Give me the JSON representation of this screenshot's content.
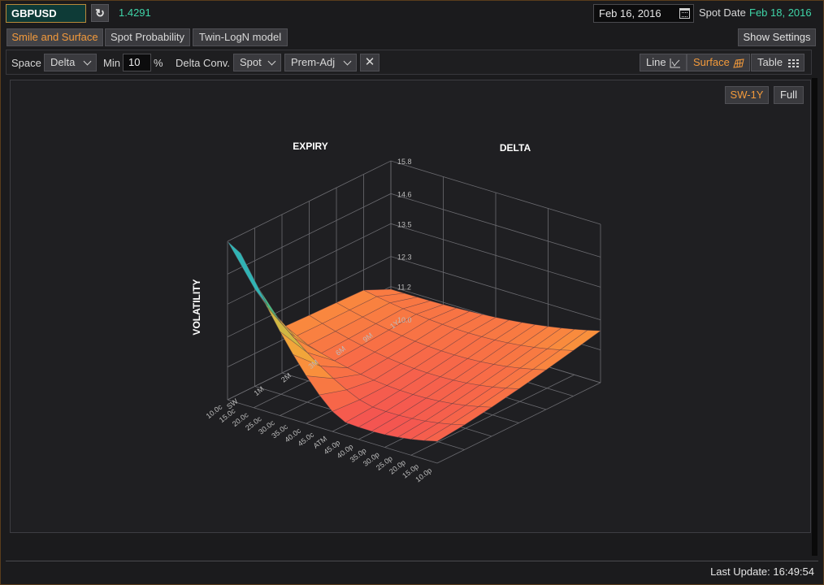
{
  "header": {
    "ticker": "GBPUSD",
    "spot": "1.4291",
    "date": "Feb 16, 2016",
    "spot_date_label": "Spot Date",
    "spot_date_value": "Feb 18, 2016"
  },
  "tabs": [
    {
      "label": "Smile and Surface",
      "active": true
    },
    {
      "label": "Spot Probability",
      "active": false
    },
    {
      "label": "Twin-LogN model",
      "active": false
    }
  ],
  "show_settings": "Show Settings",
  "toolbar": {
    "space_label": "Space",
    "space_value": "Delta",
    "min_label": "Min",
    "min_value": "10",
    "pct": "%",
    "delta_conv_label": "Delta Conv.",
    "delta_conv_value": "Spot",
    "premium_value": "Prem-Adj",
    "clear_symbol": "✕",
    "views": [
      {
        "label": "Line",
        "icon": "line-chart-icon",
        "active": false
      },
      {
        "label": "Surface",
        "icon": "surface-chart-icon",
        "active": true
      },
      {
        "label": "Table",
        "icon": "table-icon",
        "active": false
      }
    ]
  },
  "chart_controls": {
    "sw": "SW-1Y",
    "full": "Full"
  },
  "chart_data": {
    "type": "surface",
    "axis_titles": {
      "expiry": "EXPIRY",
      "delta": "DELTA",
      "volatility": "VOLATILITY"
    },
    "delta_ticks": [
      "10.0p",
      "15.0p",
      "20.0p",
      "25.0p",
      "30.0p",
      "35.0p",
      "40.0p",
      "45.0p",
      "ATM",
      "45.0c",
      "40.0c",
      "35.0c",
      "30.0c",
      "25.0c",
      "20.0c",
      "15.0c",
      "10.0c"
    ],
    "expiry_ticks": [
      "SW",
      "1M",
      "2M",
      "3M",
      "6M",
      "9M",
      "1Y"
    ],
    "z_ticks": [
      "10.0",
      "11.2",
      "12.3",
      "13.5",
      "14.6",
      "15.8"
    ],
    "zlim": [
      10.0,
      15.8
    ],
    "grid": true,
    "colors": {
      "low": "#f0405a",
      "high": "#5c4fd6"
    }
  },
  "footer": {
    "last_update": "Last Update: 16:49:54"
  }
}
